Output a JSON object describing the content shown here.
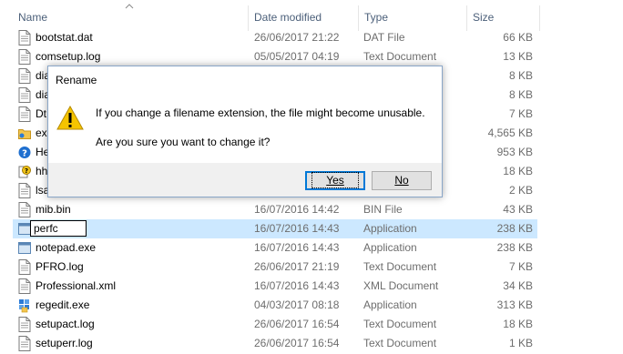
{
  "columns": {
    "name": "Name",
    "date": "Date modified",
    "type": "Type",
    "size": "Size"
  },
  "files": [
    {
      "name": "bootstat.dat",
      "date": "26/06/2017 21:22",
      "type": "DAT File",
      "size": "66 KB",
      "icon": "document-icon"
    },
    {
      "name": "comsetup.log",
      "date": "05/05/2017 04:19",
      "type": "Text Document",
      "size": "13 KB",
      "icon": "document-icon"
    },
    {
      "name": "dia",
      "date": "",
      "type": "",
      "size": "8 KB",
      "icon": "document-icon"
    },
    {
      "name": "dia",
      "date": "",
      "type": "",
      "size": "8 KB",
      "icon": "document-icon"
    },
    {
      "name": "Dt",
      "date": "",
      "type": "",
      "size": "7 KB",
      "icon": "document-icon"
    },
    {
      "name": "ex",
      "date": "",
      "type": "",
      "size": "4,565 KB",
      "icon": "explorer-folder-icon"
    },
    {
      "name": "He",
      "date": "",
      "type": "",
      "size": "953 KB",
      "icon": "help-icon"
    },
    {
      "name": "hh",
      "date": "",
      "type": "",
      "size": "18 KB",
      "icon": "html-help-icon"
    },
    {
      "name": "lsa",
      "date": "",
      "type": "",
      "size": "2 KB",
      "icon": "document-icon"
    },
    {
      "name": "mib.bin",
      "date": "16/07/2016 14:42",
      "type": "BIN File",
      "size": "43 KB",
      "icon": "document-icon"
    },
    {
      "name": "perfc",
      "date": "16/07/2016 14:43",
      "type": "Application",
      "size": "238 KB",
      "icon": "application-icon",
      "selected": true,
      "renaming": true
    },
    {
      "name": "notepad.exe",
      "date": "16/07/2016 14:43",
      "type": "Application",
      "size": "238 KB",
      "icon": "application-icon"
    },
    {
      "name": "PFRO.log",
      "date": "26/06/2017 21:19",
      "type": "Text Document",
      "size": "7 KB",
      "icon": "document-icon"
    },
    {
      "name": "Professional.xml",
      "date": "16/07/2016 14:43",
      "type": "XML Document",
      "size": "34 KB",
      "icon": "document-icon"
    },
    {
      "name": "regedit.exe",
      "date": "04/03/2017 08:18",
      "type": "Application",
      "size": "313 KB",
      "icon": "regedit-icon"
    },
    {
      "name": "setupact.log",
      "date": "26/06/2017 16:54",
      "type": "Text Document",
      "size": "18 KB",
      "icon": "document-icon"
    },
    {
      "name": "setuperr.log",
      "date": "26/06/2017 16:54",
      "type": "Text Document",
      "size": "1 KB",
      "icon": "document-icon"
    }
  ],
  "dialog": {
    "title": "Rename",
    "message": "If you change a filename extension, the file might become unusable.",
    "question": "Are you sure you want to change it?",
    "yes_label": "Yes",
    "no_label": "No"
  },
  "colors": {
    "selection": "#cce8ff",
    "header_text": "#4c607a",
    "warning_yellow": "#f5c400"
  }
}
